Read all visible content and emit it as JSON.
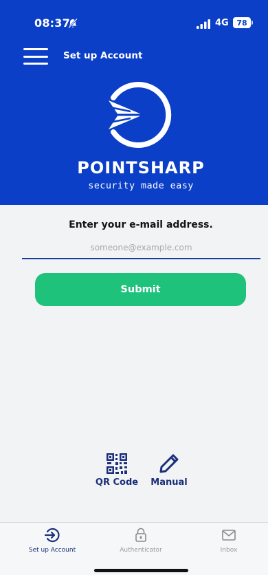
{
  "status_bar": {
    "time": "08:37",
    "network": "4G",
    "battery": "78"
  },
  "header": {
    "title": "Set up Account",
    "brand_name": "POINTSHARP",
    "tagline": "security made easy"
  },
  "form": {
    "prompt": "Enter your e-mail address.",
    "email_placeholder": "someone@example.com",
    "email_value": "",
    "submit_label": "Submit"
  },
  "options": [
    {
      "label": "QR Code",
      "icon": "qr-code-icon"
    },
    {
      "label": "Manual",
      "icon": "pencil-icon"
    }
  ],
  "tabs": [
    {
      "label": "Set up Account",
      "icon": "login-arrow-icon",
      "active": true
    },
    {
      "label": "Authenticator",
      "icon": "lock-icon",
      "active": false
    },
    {
      "label": "Inbox",
      "icon": "envelope-icon",
      "active": false
    }
  ],
  "colors": {
    "brand_blue": "#0b3fc7",
    "accent_green": "#1ec27a",
    "dark_blue": "#1b2f7a"
  }
}
